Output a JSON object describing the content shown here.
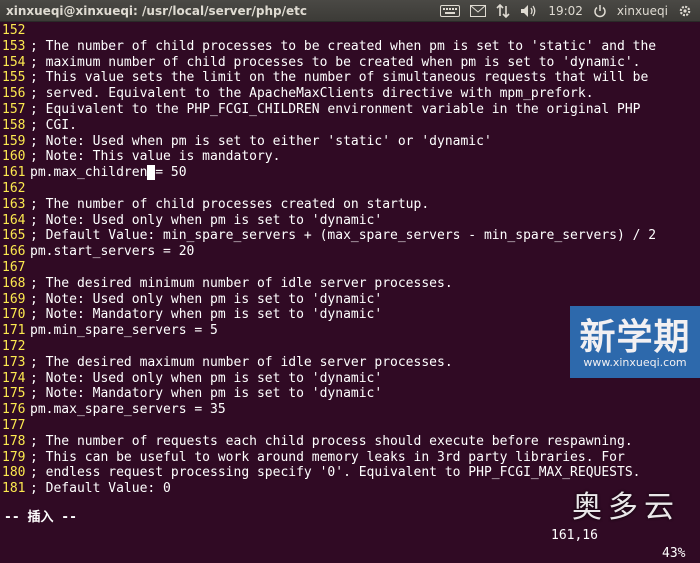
{
  "window": {
    "title": "xinxueqi@xinxueqi: /usr/local/server/php/etc"
  },
  "panel": {
    "clock": "19:02",
    "user": "xinxueqi",
    "indicator_icons": [
      "keyboard-icon",
      "mail-icon",
      "network-icon",
      "volume-icon"
    ]
  },
  "editor": {
    "lines": [
      {
        "num": "152",
        "text": ""
      },
      {
        "num": "153",
        "text": "; The number of child processes to be created when pm is set to 'static' and the"
      },
      {
        "num": "154",
        "text": "; maximum number of child processes to be created when pm is set to 'dynamic'."
      },
      {
        "num": "155",
        "text": "; This value sets the limit on the number of simultaneous requests that will be"
      },
      {
        "num": "156",
        "text": "; served. Equivalent to the ApacheMaxClients directive with mpm_prefork."
      },
      {
        "num": "157",
        "text": "; Equivalent to the PHP_FCGI_CHILDREN environment variable in the original PHP"
      },
      {
        "num": "158",
        "text": "; CGI."
      },
      {
        "num": "159",
        "text": "; Note: Used when pm is set to either 'static' or 'dynamic'"
      },
      {
        "num": "160",
        "text": "; Note: This value is mandatory."
      },
      {
        "num": "161",
        "before": "pm.max_children",
        "cursor": " ",
        "after": "= 50"
      },
      {
        "num": "162",
        "text": ""
      },
      {
        "num": "163",
        "text": "; The number of child processes created on startup."
      },
      {
        "num": "164",
        "text": "; Note: Used only when pm is set to 'dynamic'"
      },
      {
        "num": "165",
        "text": "; Default Value: min_spare_servers + (max_spare_servers - min_spare_servers) / 2"
      },
      {
        "num": "166",
        "text": "pm.start_servers = 20"
      },
      {
        "num": "167",
        "text": ""
      },
      {
        "num": "168",
        "text": "; The desired minimum number of idle server processes."
      },
      {
        "num": "169",
        "text": "; Note: Used only when pm is set to 'dynamic'"
      },
      {
        "num": "170",
        "text": "; Note: Mandatory when pm is set to 'dynamic'"
      },
      {
        "num": "171",
        "text": "pm.min_spare_servers = 5"
      },
      {
        "num": "172",
        "text": ""
      },
      {
        "num": "173",
        "text": "; The desired maximum number of idle server processes."
      },
      {
        "num": "174",
        "text": "; Note: Used only when pm is set to 'dynamic'"
      },
      {
        "num": "175",
        "text": "; Note: Mandatory when pm is set to 'dynamic'"
      },
      {
        "num": "176",
        "text": "pm.max_spare_servers = 35"
      },
      {
        "num": "177",
        "text": ""
      },
      {
        "num": "178",
        "text": "; The number of requests each child process should execute before respawning."
      },
      {
        "num": "179",
        "text": "; This can be useful to work around memory leaks in 3rd party libraries. For"
      },
      {
        "num": "180",
        "text": "; endless request processing specify '0'. Equivalent to PHP_FCGI_MAX_REQUESTS."
      },
      {
        "num": "181",
        "text": "; Default Value: 0"
      }
    ]
  },
  "status": {
    "mode": "-- 插入 --",
    "position": "161,16",
    "percent": "43%"
  },
  "watermarks": {
    "big_text": "新学期",
    "url": "www.xinxueqi.com",
    "brand": "奥多云"
  },
  "colors": {
    "terminal_bg": "#300a24",
    "line_number": "#fce94f",
    "text": "#ffffff",
    "watermark_bg": "#2d6fb5"
  }
}
